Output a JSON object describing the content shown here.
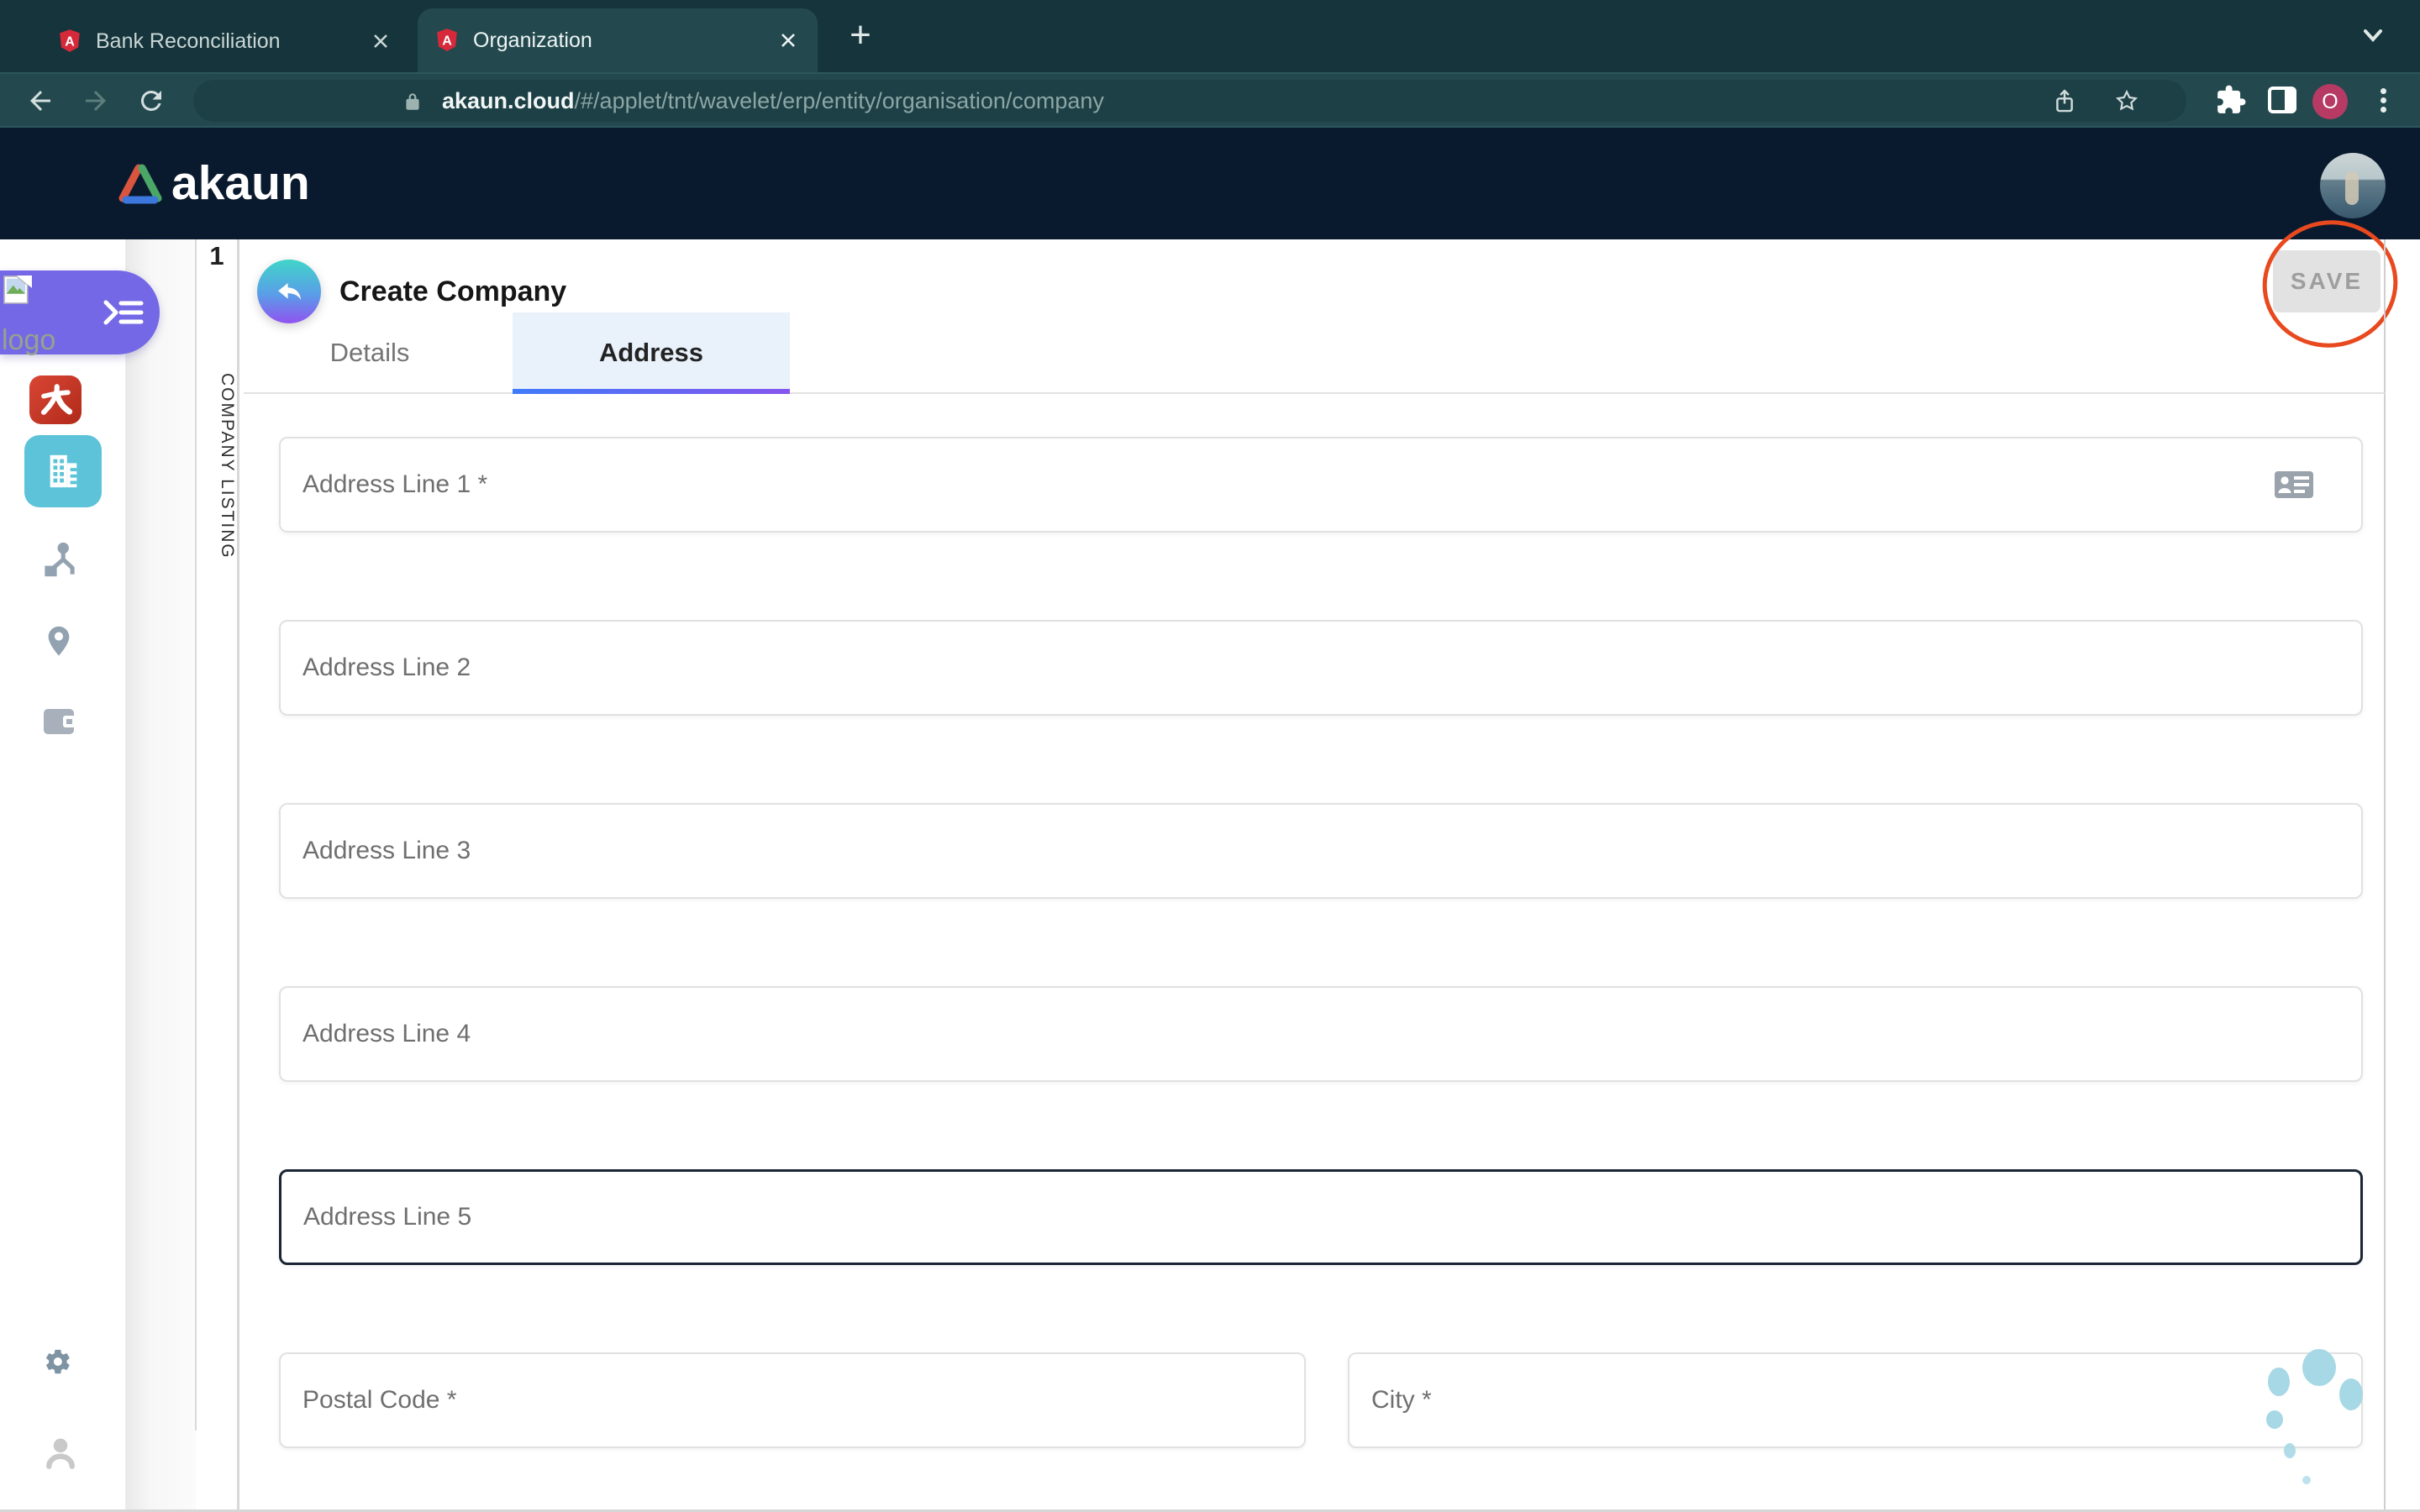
{
  "browser": {
    "tabs": [
      {
        "title": "Bank Reconciliation",
        "favicon_letter": "A",
        "active": false
      },
      {
        "title": "Organization",
        "favicon_letter": "A",
        "active": true
      }
    ],
    "new_tab_label": "+",
    "url": {
      "host": "akaun.cloud",
      "path": "/#/applet/tnt/wavelet/erp/entity/organisation/company"
    },
    "profile_initial": "O"
  },
  "app_header": {
    "brand": "akaun"
  },
  "sidebar": {
    "logo_alt": "logo",
    "apps": [
      "dai-app",
      "organization-app-active",
      "org-structure",
      "locations",
      "wallet"
    ],
    "footer": [
      "settings",
      "account"
    ]
  },
  "listing_panel": {
    "index": "1",
    "label": "COMPANY LISTING"
  },
  "page": {
    "title": "Create Company",
    "tabs": [
      {
        "label": "Details",
        "active": false
      },
      {
        "label": "Address",
        "active": true
      }
    ],
    "save_label": "SAVE"
  },
  "form": {
    "fields": [
      {
        "placeholder": "Address Line 1 *",
        "required": true,
        "trailing_icon": "contact-card"
      },
      {
        "placeholder": "Address Line 2"
      },
      {
        "placeholder": "Address Line 3"
      },
      {
        "placeholder": "Address Line 4"
      },
      {
        "placeholder": "Address Line 5",
        "focused": true
      }
    ],
    "row": [
      {
        "placeholder": "Postal Code *",
        "required": true
      },
      {
        "placeholder": "City *",
        "required": true
      }
    ]
  },
  "colors": {
    "tabstrip_bg": "#16343b",
    "toolbar_bg": "#23494f",
    "url_pill_bg": "#1c4046",
    "app_header_bg": "#0a1a2e",
    "logo_pill": "#7568e6",
    "active_tile": "#5cc3d8",
    "red_tile": "#c93a28",
    "active_tab_bg": "#e9f1fb",
    "tab_underline": [
      "#3e7bfa",
      "#8656ee"
    ],
    "field_border": "#e1e1e1",
    "focused_border": "#1b2534",
    "save_bg": "#e2e2e2",
    "save_text": "#9e9e9e",
    "annotation_red": "#e8491f",
    "dots_blue": "#a7d8e5",
    "profile_chip": "#b63a64"
  }
}
